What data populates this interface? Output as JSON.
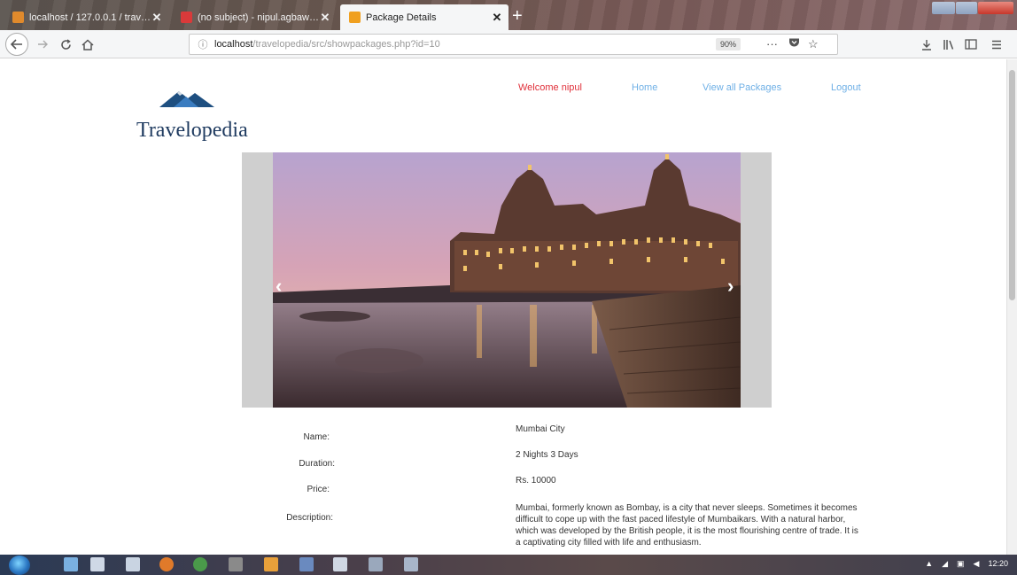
{
  "browser": {
    "tabs": [
      {
        "title": "localhost / 127.0.0.1 / travelop",
        "favicon_color": "#e08a2c",
        "active": false
      },
      {
        "title": "(no subject) - nipul.agbaw@",
        "favicon_color": "#d93a3a",
        "active": false
      },
      {
        "title": "Package Details",
        "favicon_color": "#f0a020",
        "active": true
      }
    ],
    "close_glyph": "✕",
    "new_tab_glyph": "+",
    "url_prefix": "localhost",
    "url_rest": "/travelopedia/src/showpackages.php?id=10",
    "zoom": "90%"
  },
  "header": {
    "logo_text": "Travelopedia",
    "welcome": "Welcome nipul",
    "nav": [
      {
        "label": "Home"
      },
      {
        "label": "View all Packages"
      },
      {
        "label": "Logout"
      }
    ]
  },
  "carousel": {
    "prev": "‹",
    "next": "›"
  },
  "details": {
    "name_label": "Name:",
    "name_value": "Mumbai City",
    "duration_label": "Duration:",
    "duration_value": "2 Nights 3 Days",
    "price_label": "Price:",
    "price_value": "Rs. 10000",
    "description_label": "Description:",
    "description_value": "Mumbai, formerly known as Bombay, is a city that never sleeps. Sometimes it becomes difficult to cope up with the fast paced lifestyle of Mumbaikars. With a natural harbor, which was developed by the British people, it is the most flourishing centre of trade. It is a captivating city filled with life and enthusiasm."
  },
  "taskbar": {
    "time": "12:20"
  },
  "colors": {
    "nav_link": "#6fb0e6",
    "welcome": "#e0303a",
    "logo_text": "#1e3a5f"
  }
}
